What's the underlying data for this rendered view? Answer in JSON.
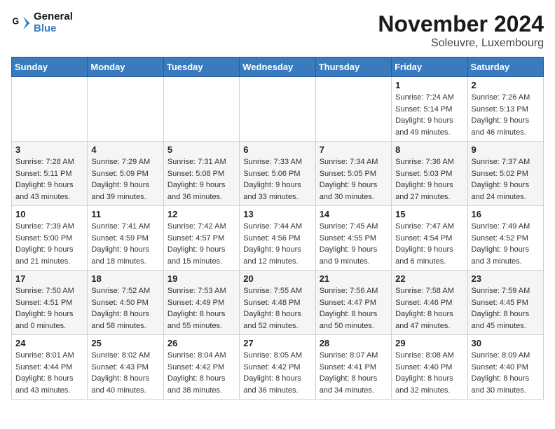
{
  "logo": {
    "line1": "General",
    "line2": "Blue"
  },
  "title": "November 2024",
  "location": "Soleuvre, Luxembourg",
  "headers": [
    "Sunday",
    "Monday",
    "Tuesday",
    "Wednesday",
    "Thursday",
    "Friday",
    "Saturday"
  ],
  "weeks": [
    [
      {
        "day": "",
        "info": ""
      },
      {
        "day": "",
        "info": ""
      },
      {
        "day": "",
        "info": ""
      },
      {
        "day": "",
        "info": ""
      },
      {
        "day": "",
        "info": ""
      },
      {
        "day": "1",
        "info": "Sunrise: 7:24 AM\nSunset: 5:14 PM\nDaylight: 9 hours\nand 49 minutes."
      },
      {
        "day": "2",
        "info": "Sunrise: 7:26 AM\nSunset: 5:13 PM\nDaylight: 9 hours\nand 46 minutes."
      }
    ],
    [
      {
        "day": "3",
        "info": "Sunrise: 7:28 AM\nSunset: 5:11 PM\nDaylight: 9 hours\nand 43 minutes."
      },
      {
        "day": "4",
        "info": "Sunrise: 7:29 AM\nSunset: 5:09 PM\nDaylight: 9 hours\nand 39 minutes."
      },
      {
        "day": "5",
        "info": "Sunrise: 7:31 AM\nSunset: 5:08 PM\nDaylight: 9 hours\nand 36 minutes."
      },
      {
        "day": "6",
        "info": "Sunrise: 7:33 AM\nSunset: 5:06 PM\nDaylight: 9 hours\nand 33 minutes."
      },
      {
        "day": "7",
        "info": "Sunrise: 7:34 AM\nSunset: 5:05 PM\nDaylight: 9 hours\nand 30 minutes."
      },
      {
        "day": "8",
        "info": "Sunrise: 7:36 AM\nSunset: 5:03 PM\nDaylight: 9 hours\nand 27 minutes."
      },
      {
        "day": "9",
        "info": "Sunrise: 7:37 AM\nSunset: 5:02 PM\nDaylight: 9 hours\nand 24 minutes."
      }
    ],
    [
      {
        "day": "10",
        "info": "Sunrise: 7:39 AM\nSunset: 5:00 PM\nDaylight: 9 hours\nand 21 minutes."
      },
      {
        "day": "11",
        "info": "Sunrise: 7:41 AM\nSunset: 4:59 PM\nDaylight: 9 hours\nand 18 minutes."
      },
      {
        "day": "12",
        "info": "Sunrise: 7:42 AM\nSunset: 4:57 PM\nDaylight: 9 hours\nand 15 minutes."
      },
      {
        "day": "13",
        "info": "Sunrise: 7:44 AM\nSunset: 4:56 PM\nDaylight: 9 hours\nand 12 minutes."
      },
      {
        "day": "14",
        "info": "Sunrise: 7:45 AM\nSunset: 4:55 PM\nDaylight: 9 hours\nand 9 minutes."
      },
      {
        "day": "15",
        "info": "Sunrise: 7:47 AM\nSunset: 4:54 PM\nDaylight: 9 hours\nand 6 minutes."
      },
      {
        "day": "16",
        "info": "Sunrise: 7:49 AM\nSunset: 4:52 PM\nDaylight: 9 hours\nand 3 minutes."
      }
    ],
    [
      {
        "day": "17",
        "info": "Sunrise: 7:50 AM\nSunset: 4:51 PM\nDaylight: 9 hours\nand 0 minutes."
      },
      {
        "day": "18",
        "info": "Sunrise: 7:52 AM\nSunset: 4:50 PM\nDaylight: 8 hours\nand 58 minutes."
      },
      {
        "day": "19",
        "info": "Sunrise: 7:53 AM\nSunset: 4:49 PM\nDaylight: 8 hours\nand 55 minutes."
      },
      {
        "day": "20",
        "info": "Sunrise: 7:55 AM\nSunset: 4:48 PM\nDaylight: 8 hours\nand 52 minutes."
      },
      {
        "day": "21",
        "info": "Sunrise: 7:56 AM\nSunset: 4:47 PM\nDaylight: 8 hours\nand 50 minutes."
      },
      {
        "day": "22",
        "info": "Sunrise: 7:58 AM\nSunset: 4:46 PM\nDaylight: 8 hours\nand 47 minutes."
      },
      {
        "day": "23",
        "info": "Sunrise: 7:59 AM\nSunset: 4:45 PM\nDaylight: 8 hours\nand 45 minutes."
      }
    ],
    [
      {
        "day": "24",
        "info": "Sunrise: 8:01 AM\nSunset: 4:44 PM\nDaylight: 8 hours\nand 43 minutes."
      },
      {
        "day": "25",
        "info": "Sunrise: 8:02 AM\nSunset: 4:43 PM\nDaylight: 8 hours\nand 40 minutes."
      },
      {
        "day": "26",
        "info": "Sunrise: 8:04 AM\nSunset: 4:42 PM\nDaylight: 8 hours\nand 38 minutes."
      },
      {
        "day": "27",
        "info": "Sunrise: 8:05 AM\nSunset: 4:42 PM\nDaylight: 8 hours\nand 36 minutes."
      },
      {
        "day": "28",
        "info": "Sunrise: 8:07 AM\nSunset: 4:41 PM\nDaylight: 8 hours\nand 34 minutes."
      },
      {
        "day": "29",
        "info": "Sunrise: 8:08 AM\nSunset: 4:40 PM\nDaylight: 8 hours\nand 32 minutes."
      },
      {
        "day": "30",
        "info": "Sunrise: 8:09 AM\nSunset: 4:40 PM\nDaylight: 8 hours\nand 30 minutes."
      }
    ]
  ]
}
